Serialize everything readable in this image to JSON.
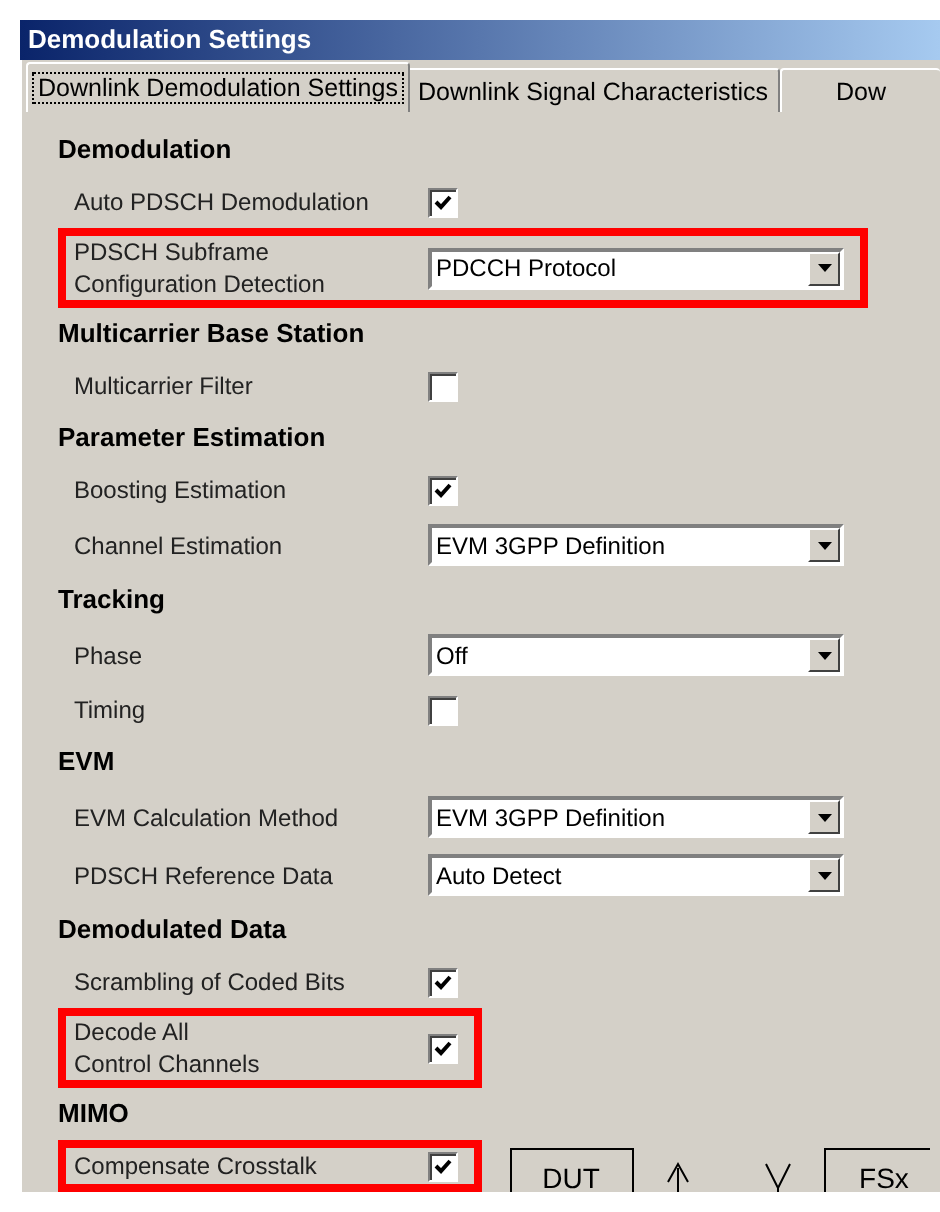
{
  "window": {
    "title": "Demodulation Settings"
  },
  "tabs": [
    {
      "label": "Downlink Demodulation Settings",
      "selected": true
    },
    {
      "label": "Downlink Signal Characteristics",
      "selected": false
    },
    {
      "label": "Dow",
      "selected": false
    }
  ],
  "sections": [
    {
      "title": "Demodulation",
      "rows": [
        {
          "kind": "checkbox",
          "label": "Auto PDSCH Demodulation",
          "checked": true,
          "highlighted": false
        },
        {
          "kind": "dropdown",
          "label": "PDSCH Subframe\nConfiguration Detection",
          "value": "PDCCH Protocol",
          "highlighted": true
        }
      ]
    },
    {
      "title": "Multicarrier Base Station",
      "rows": [
        {
          "kind": "checkbox",
          "label": "Multicarrier Filter",
          "checked": false,
          "highlighted": false
        }
      ]
    },
    {
      "title": "Parameter Estimation",
      "rows": [
        {
          "kind": "checkbox",
          "label": "Boosting Estimation",
          "checked": true,
          "highlighted": false
        },
        {
          "kind": "dropdown",
          "label": "Channel Estimation",
          "value": "EVM 3GPP Definition",
          "highlighted": false
        }
      ]
    },
    {
      "title": "Tracking",
      "rows": [
        {
          "kind": "dropdown",
          "label": "Phase",
          "value": "Off",
          "highlighted": false
        },
        {
          "kind": "checkbox",
          "label": "Timing",
          "checked": false,
          "highlighted": false
        }
      ]
    },
    {
      "title": "EVM",
      "rows": [
        {
          "kind": "dropdown",
          "label": "EVM Calculation Method",
          "value": "EVM 3GPP Definition",
          "highlighted": false
        },
        {
          "kind": "dropdown",
          "label": "PDSCH Reference Data",
          "value": "Auto Detect",
          "highlighted": false
        }
      ]
    },
    {
      "title": "Demodulated Data",
      "rows": [
        {
          "kind": "checkbox",
          "label": "Scrambling of Coded Bits",
          "checked": true,
          "highlighted": false
        },
        {
          "kind": "checkbox",
          "label": "Decode All\nControl Channels",
          "checked": true,
          "highlighted": true
        }
      ]
    },
    {
      "title": "MIMO",
      "rows": [
        {
          "kind": "checkbox",
          "label": "Compensate Crosstalk",
          "checked": true,
          "highlighted": true
        }
      ]
    }
  ],
  "diagram": {
    "blocks": [
      "DUT",
      "FSx"
    ]
  }
}
